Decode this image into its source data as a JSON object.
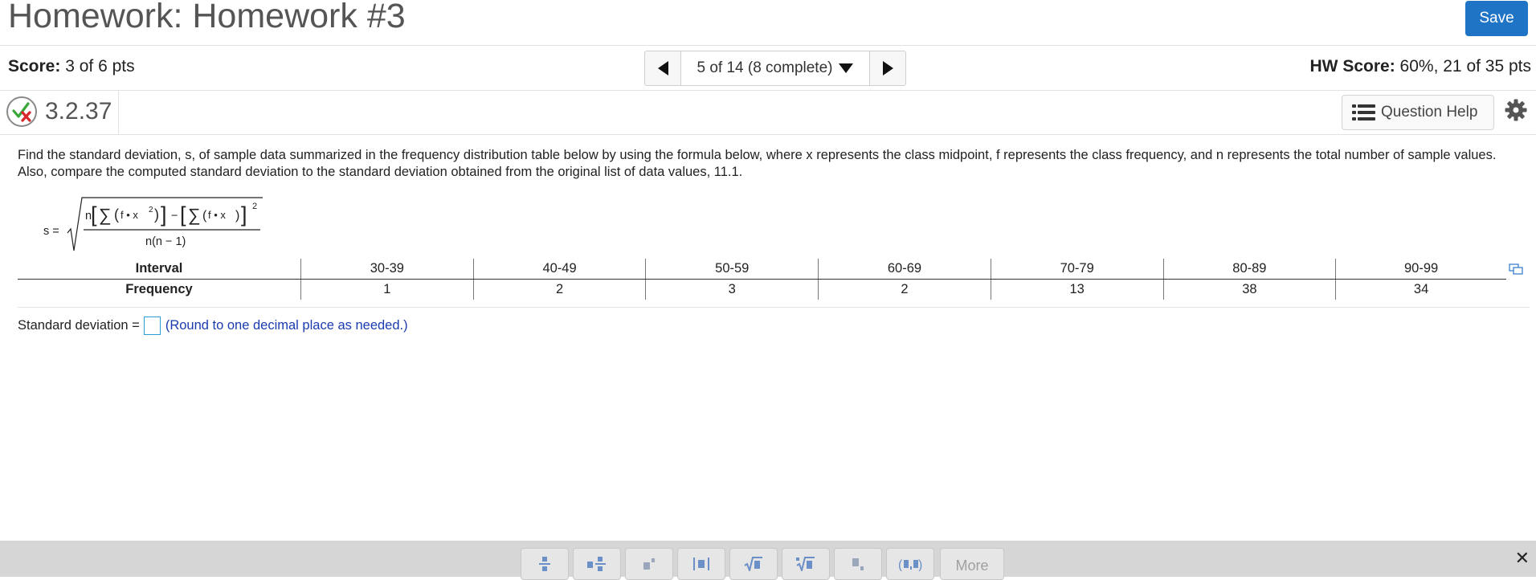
{
  "header": {
    "title": "Homework: Homework #3",
    "save_label": "Save"
  },
  "scorebar": {
    "score_label": "Score:",
    "score_value": "3 of 6 pts",
    "nav_text": "5 of 14 (8 complete)",
    "hw_label": "HW Score:",
    "hw_value": "60%, 21 of 35 pts"
  },
  "question": {
    "number": "3.2.37",
    "help_label": "Question Help"
  },
  "prompt": "Find the standard deviation, s, of sample data summarized in the frequency distribution table below by using the formula below, where x represents the class midpoint, f represents the class frequency, and n represents the total number of sample values. Also, compare the computed standard deviation to the standard deviation obtained from the original list of data values, 11.1.",
  "formula": {
    "lhs": "s =",
    "n": "n",
    "sigma": "∑",
    "fx2": "f • x",
    "exp2": "2",
    "minus": "−",
    "fx": "f • x",
    "den": "n(n − 1)"
  },
  "table": {
    "row_labels": [
      "Interval",
      "Frequency"
    ],
    "intervals": [
      "30-39",
      "40-49",
      "50-59",
      "60-69",
      "70-79",
      "80-89",
      "90-99"
    ],
    "frequencies": [
      "1",
      "2",
      "3",
      "2",
      "13",
      "38",
      "34"
    ]
  },
  "answer": {
    "label": "Standard deviation =",
    "hint": "(Round to one decimal place as needed.)"
  },
  "toolbar": {
    "more_label": "More",
    "close_label": "✕"
  },
  "icons": [
    "check-x-icon",
    "list-icon",
    "gear-icon",
    "expand-icon",
    "fraction-icon",
    "mixed-number-icon",
    "exponent-icon",
    "absolute-value-icon",
    "square-root-icon",
    "nth-root-icon",
    "subscript-icon",
    "ordered-pair-icon",
    "close-icon"
  ],
  "colors": {
    "save_button": "#1f74c6",
    "hint_text": "#1a3cb0",
    "input_border": "#2a9fd6",
    "toolbar_bg": "#d6d6d6"
  }
}
